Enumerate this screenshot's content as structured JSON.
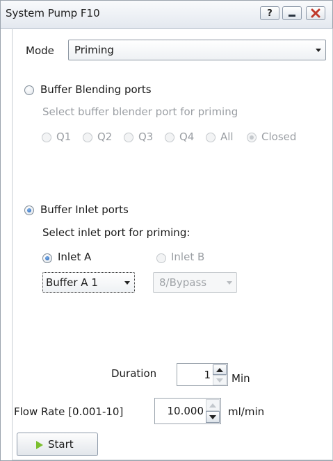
{
  "window": {
    "title": "System Pump F10",
    "help_label": "?",
    "minimize_icon": "minimize-icon",
    "close_icon": "close-icon",
    "close_color": "#c0392b"
  },
  "mode": {
    "label": "Mode",
    "value": "Priming"
  },
  "blending": {
    "label": "Buffer Blending ports",
    "instruction": "Select buffer blender port for priming",
    "options": [
      "Q1",
      "Q2",
      "Q3",
      "Q4",
      "All",
      "Closed"
    ],
    "selected": "Closed"
  },
  "inlet": {
    "label": "Buffer Inlet ports",
    "instruction": "Select inlet port for priming:",
    "inlet_a": {
      "label": "Inlet A",
      "value": "Buffer A 1"
    },
    "inlet_b": {
      "label": "Inlet B",
      "value": "8/Bypass"
    }
  },
  "duration": {
    "label": "Duration",
    "value": "1",
    "unit": "Min"
  },
  "flow_rate": {
    "label": "Flow Rate [0.001-10]",
    "value": "10.000",
    "unit": "ml/min"
  },
  "start": {
    "label": "Start",
    "icon": "play-icon",
    "icon_color": "#7bbf2e"
  },
  "colors": {
    "accent_radio": "#1e5fb4",
    "disabled_text": "#9a9ea3"
  }
}
